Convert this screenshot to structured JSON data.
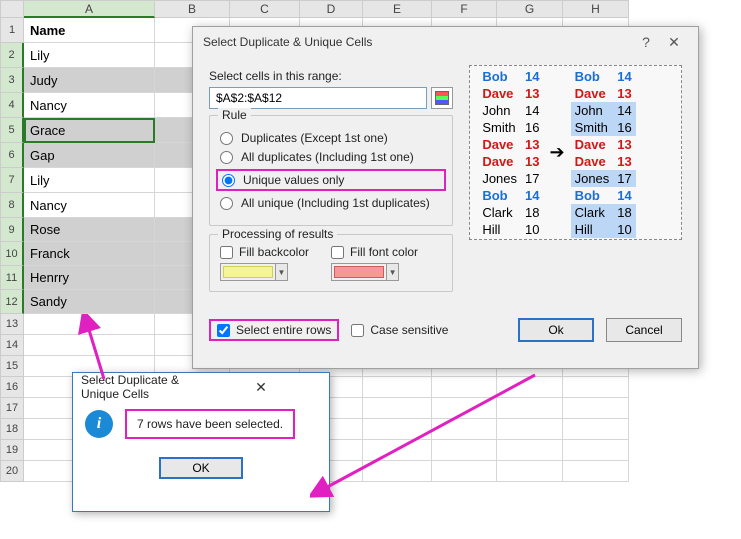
{
  "columns": [
    "A",
    "B",
    "C",
    "D",
    "E",
    "F",
    "G",
    "H"
  ],
  "rows": [
    {
      "n": 1,
      "a": "Name",
      "bold": true,
      "hl": false,
      "h": "h25"
    },
    {
      "n": 2,
      "a": "Lily",
      "hl": false,
      "h": "h25"
    },
    {
      "n": 3,
      "a": "Judy",
      "hl": true,
      "h": "h25"
    },
    {
      "n": 4,
      "a": "Nancy",
      "hl": false,
      "h": "h25"
    },
    {
      "n": 5,
      "a": "Grace",
      "hl": true,
      "h": "h25",
      "active": true
    },
    {
      "n": 6,
      "a": "Gap",
      "hl": true,
      "h": "h25"
    },
    {
      "n": 7,
      "a": "Lily",
      "hl": false,
      "h": "h25"
    },
    {
      "n": 8,
      "a": "Nancy",
      "hl": false,
      "h": "h25"
    },
    {
      "n": 9,
      "a": "Rose",
      "hl": true,
      "h": "h24"
    },
    {
      "n": 10,
      "a": "Franck",
      "hl": true,
      "h": "h24"
    },
    {
      "n": 11,
      "a": "Henrry",
      "hl": true,
      "h": "h24"
    },
    {
      "n": 12,
      "a": "Sandy",
      "hl": true,
      "h": "h24"
    },
    {
      "n": 13,
      "a": "",
      "hl": false,
      "h": "h21"
    },
    {
      "n": 14,
      "a": "",
      "hl": false,
      "h": "h21"
    },
    {
      "n": 15,
      "a": "",
      "hl": false,
      "h": "h21"
    },
    {
      "n": 16,
      "a": "",
      "hl": false,
      "h": "h21"
    },
    {
      "n": 17,
      "a": "",
      "hl": false,
      "h": "h21"
    },
    {
      "n": 18,
      "a": "",
      "hl": false,
      "h": "h21"
    },
    {
      "n": 19,
      "a": "",
      "hl": false,
      "h": "h21"
    },
    {
      "n": 20,
      "a": "",
      "hl": false,
      "h": "h21"
    }
  ],
  "dialog1": {
    "title": "Select Duplicate & Unique Cells",
    "select_label": "Select cells in this range:",
    "range_value": "$A$2:$A$12",
    "rule_title": "Rule",
    "rule_options": {
      "dup_except": "Duplicates (Except 1st one)",
      "all_dup": "All duplicates (Including 1st one)",
      "unique_only": "Unique values only",
      "all_unique": "All unique (Including 1st duplicates)"
    },
    "proc_title": "Processing of results",
    "fill_back": "Fill backcolor",
    "fill_font": "Fill font color",
    "select_rows": "Select entire rows",
    "case_sensitive": "Case sensitive",
    "ok": "Ok",
    "cancel": "Cancel",
    "preview": {
      "left": [
        [
          "Bob",
          "14",
          "pblue"
        ],
        [
          "Dave",
          "13",
          "pred"
        ],
        [
          "John",
          "14",
          ""
        ],
        [
          "Smith",
          "16",
          ""
        ],
        [
          "Dave",
          "13",
          "pred"
        ],
        [
          "Dave",
          "13",
          "pred"
        ],
        [
          "Jones",
          "17",
          ""
        ],
        [
          "Bob",
          "14",
          "pblue"
        ],
        [
          "Clark",
          "18",
          ""
        ],
        [
          "Hill",
          "10",
          ""
        ]
      ],
      "right": [
        [
          "Bob",
          "14",
          "pblue",
          ""
        ],
        [
          "Dave",
          "13",
          "pred",
          ""
        ],
        [
          "John",
          "14",
          "",
          "phl"
        ],
        [
          "Smith",
          "16",
          "",
          "phl"
        ],
        [
          "Dave",
          "13",
          "pred",
          ""
        ],
        [
          "Dave",
          "13",
          "pred",
          ""
        ],
        [
          "Jones",
          "17",
          "",
          "phl"
        ],
        [
          "Bob",
          "14",
          "pblue",
          ""
        ],
        [
          "Clark",
          "18",
          "",
          "phl pbox"
        ],
        [
          "Hill",
          "10",
          "",
          "phl"
        ]
      ]
    }
  },
  "dialog2": {
    "title": "Select Duplicate & Unique Cells",
    "message": "7 rows have been selected.",
    "ok": "OK"
  }
}
